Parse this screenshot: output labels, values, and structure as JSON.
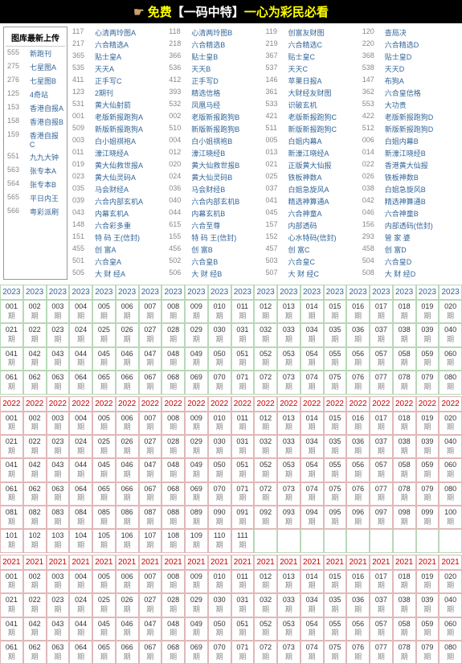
{
  "banner": {
    "hand": "☛",
    "t1": "免费",
    "t2": "【一码中特】",
    "t3": "一心为彩民必看"
  },
  "sidebar": {
    "title": "图库最新上传",
    "items": [
      {
        "n": "555",
        "l": "新跑刊"
      },
      {
        "n": "275",
        "l": "七星图A"
      },
      {
        "n": "276",
        "l": "七星图B"
      },
      {
        "n": "125",
        "l": "4奇站"
      },
      {
        "n": "153",
        "l": "香港自报A"
      },
      {
        "n": "158",
        "l": "香港自报B"
      },
      {
        "n": "159",
        "l": "香港自报C"
      },
      {
        "n": "551",
        "l": "九九大钟"
      },
      {
        "n": "563",
        "l": "张专本A"
      },
      {
        "n": "564",
        "l": "张专本B"
      },
      {
        "n": "565",
        "l": "平日内王"
      },
      {
        "n": "566",
        "l": "粤彩派刷"
      }
    ]
  },
  "links": [
    [
      {
        "n": "117",
        "l": "心清两玲图A"
      },
      {
        "n": "118",
        "l": "心清两玲图B"
      },
      {
        "n": "119",
        "l": "创富友财图"
      },
      {
        "n": "120",
        "l": "查局决"
      }
    ],
    [
      {
        "n": "217",
        "l": "六合精选A"
      },
      {
        "n": "218",
        "l": "六合精选B"
      },
      {
        "n": "219",
        "l": "六合精选C"
      },
      {
        "n": "220",
        "l": "六合精选D"
      }
    ],
    [
      {
        "n": "365",
        "l": "贴士皇A"
      },
      {
        "n": "366",
        "l": "贴士皇B"
      },
      {
        "n": "367",
        "l": "贴士皇C"
      },
      {
        "n": "368",
        "l": "贴士皇D"
      }
    ],
    [
      {
        "n": "535",
        "l": "天天A"
      },
      {
        "n": "536",
        "l": "天天B"
      },
      {
        "n": "537",
        "l": "天天C"
      },
      {
        "n": "538",
        "l": "天天D"
      }
    ],
    [
      {
        "n": "411",
        "l": "正手写C"
      },
      {
        "n": "412",
        "l": "正手写D"
      },
      {
        "n": "146",
        "l": "苹果日报A"
      },
      {
        "n": "147",
        "l": "布狗A"
      }
    ],
    [
      {
        "n": "123",
        "l": "2期刊"
      },
      {
        "n": "393",
        "l": "精选信格"
      },
      {
        "n": "361",
        "l": "大财经友财图"
      },
      {
        "n": "362",
        "l": "六合皇信格"
      }
    ],
    [
      {
        "n": "531",
        "l": "黄大仙射箭"
      },
      {
        "n": "532",
        "l": "凤凰马经"
      },
      {
        "n": "533",
        "l": "识破玄机"
      },
      {
        "n": "553",
        "l": "大功贵"
      }
    ],
    [
      {
        "n": "001",
        "l": "老版新报跑狗A"
      },
      {
        "n": "002",
        "l": "老版新报跑狗B"
      },
      {
        "n": "421",
        "l": "老版新报跑狗C"
      },
      {
        "n": "422",
        "l": "老版新报跑狗D"
      }
    ],
    [
      {
        "n": "509",
        "l": "新版新报跑狗A"
      },
      {
        "n": "510",
        "l": "新版新报跑狗B"
      },
      {
        "n": "511",
        "l": "新版新报跑狗C"
      },
      {
        "n": "512",
        "l": "新版新报跑狗D"
      }
    ],
    [
      {
        "n": "003",
        "l": "白小姐祺袍A"
      },
      {
        "n": "004",
        "l": "白小姐祺袍B"
      },
      {
        "n": "005",
        "l": "白姐内幕A"
      },
      {
        "n": "006",
        "l": "白姐内幕B"
      }
    ],
    [
      {
        "n": "011",
        "l": "濠江晓经A"
      },
      {
        "n": "012",
        "l": "濠江晓经B"
      },
      {
        "n": "013",
        "l": "新濠江晓经A"
      },
      {
        "n": "014",
        "l": "新濠江晓经B"
      }
    ],
    [
      {
        "n": "019",
        "l": "黄大仙救世报A"
      },
      {
        "n": "020",
        "l": "黄大仙救世报B"
      },
      {
        "n": "021",
        "l": "正版黄大仙报"
      },
      {
        "n": "022",
        "l": "香港黄大仙报"
      }
    ],
    [
      {
        "n": "023",
        "l": "黄大仙灵码A"
      },
      {
        "n": "024",
        "l": "黄大仙灵码B"
      },
      {
        "n": "025",
        "l": "铁板神数A"
      },
      {
        "n": "026",
        "l": "铁板神数B"
      }
    ],
    [
      {
        "n": "035",
        "l": "马会财经A"
      },
      {
        "n": "036",
        "l": "马会财经B"
      },
      {
        "n": "037",
        "l": "白姐急旋风A"
      },
      {
        "n": "038",
        "l": "白姐急旋风B"
      }
    ],
    [
      {
        "n": "039",
        "l": "六合内部玄机A"
      },
      {
        "n": "040",
        "l": "六合内部玄机B"
      },
      {
        "n": "041",
        "l": "精选神算通A"
      },
      {
        "n": "042",
        "l": "精选神算通B"
      }
    ],
    [
      {
        "n": "043",
        "l": "内幕玄机A"
      },
      {
        "n": "044",
        "l": "内幕玄机B"
      },
      {
        "n": "045",
        "l": "六合神童A"
      },
      {
        "n": "046",
        "l": "六合神童B"
      }
    ],
    [
      {
        "n": "148",
        "l": "六合彩多重"
      },
      {
        "n": "615",
        "l": "六合至尊"
      },
      {
        "n": "157",
        "l": "内部透码"
      },
      {
        "n": "156",
        "l": "内部透码(信封)"
      }
    ],
    [
      {
        "n": "151",
        "l": "特 码 王(信封)"
      },
      {
        "n": "155",
        "l": "特 码 王(信封)"
      },
      {
        "n": "152",
        "l": "心水特码(信封)"
      },
      {
        "n": "293",
        "l": "管 家 婆"
      }
    ],
    [
      {
        "n": "455",
        "l": "创 富A"
      },
      {
        "n": "456",
        "l": "创 富B"
      },
      {
        "n": "457",
        "l": "创 富C"
      },
      {
        "n": "458",
        "l": "创 富D"
      }
    ],
    [
      {
        "n": "501",
        "l": "六合皇A"
      },
      {
        "n": "502",
        "l": "六合皇B"
      },
      {
        "n": "503",
        "l": "六合皇C"
      },
      {
        "n": "504",
        "l": "六合皇D"
      }
    ],
    [
      {
        "n": "505",
        "l": "大 财 经A"
      },
      {
        "n": "506",
        "l": "大 财 经B"
      },
      {
        "n": "507",
        "l": "大 财 经C"
      },
      {
        "n": "508",
        "l": "大 财 经D"
      }
    ]
  ],
  "years": [
    {
      "year": "2023",
      "color": "green",
      "count": 80
    },
    {
      "year": "2022",
      "color": "red",
      "count": 111
    },
    {
      "year": "2021",
      "color": "red",
      "count": 80
    }
  ],
  "qi": "期"
}
